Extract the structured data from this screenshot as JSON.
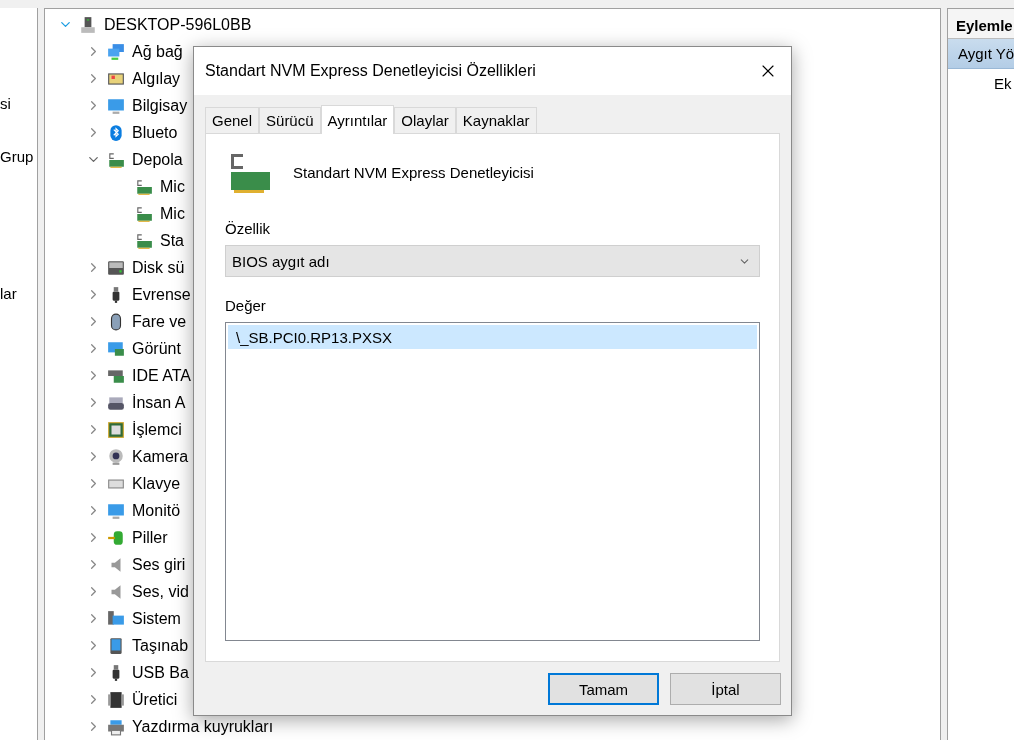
{
  "left_pane": {
    "items": [
      "si",
      "Grup",
      "lar"
    ]
  },
  "device_tree": {
    "root": {
      "label": "DESKTOP-596L0BB",
      "kind": "computer",
      "expanded": true,
      "children": [
        {
          "label": "Ağ bağ",
          "kind": "network",
          "expanded": false
        },
        {
          "label": "Algılay",
          "kind": "sensor",
          "expanded": false
        },
        {
          "label": "Bilgisay",
          "kind": "monitor",
          "expanded": false
        },
        {
          "label": "Blueto",
          "kind": "bluetooth",
          "expanded": false
        },
        {
          "label": "Depola",
          "kind": "storage",
          "expanded": true,
          "children": [
            {
              "label": "Mic",
              "kind": "storage"
            },
            {
              "label": "Mic",
              "kind": "storage"
            },
            {
              "label": "Sta",
              "kind": "storage"
            }
          ]
        },
        {
          "label": "Disk sü",
          "kind": "disk",
          "expanded": false
        },
        {
          "label": "Evrense",
          "kind": "usb",
          "expanded": false
        },
        {
          "label": "Fare ve",
          "kind": "mouse",
          "expanded": false
        },
        {
          "label": "Görünt",
          "kind": "display",
          "expanded": false
        },
        {
          "label": "IDE ATA",
          "kind": "ide",
          "expanded": false
        },
        {
          "label": "İnsan A",
          "kind": "hid",
          "expanded": false
        },
        {
          "label": "İşlemci",
          "kind": "cpu",
          "expanded": false
        },
        {
          "label": "Kamera",
          "kind": "camera",
          "expanded": false
        },
        {
          "label": "Klavye",
          "kind": "keyboard",
          "expanded": false
        },
        {
          "label": "Monitö",
          "kind": "monitor",
          "expanded": false
        },
        {
          "label": "Piller",
          "kind": "battery",
          "expanded": false
        },
        {
          "label": "Ses giri",
          "kind": "audio",
          "expanded": false
        },
        {
          "label": "Ses, vid",
          "kind": "audio",
          "expanded": false
        },
        {
          "label": "Sistem",
          "kind": "system",
          "expanded": false
        },
        {
          "label": "Taşınab",
          "kind": "portable",
          "expanded": false
        },
        {
          "label": "USB Ba",
          "kind": "usb",
          "expanded": false
        },
        {
          "label": "Üretici",
          "kind": "chip",
          "expanded": false
        },
        {
          "label": "Yazdırma kuyrukları",
          "kind": "printer",
          "expanded": false
        }
      ]
    }
  },
  "actions_pane": {
    "header": "Eylemle",
    "items": [
      {
        "label": "Aygıt Yö",
        "selected": true,
        "indent": false
      },
      {
        "label": "Ek",
        "selected": false,
        "indent": true
      }
    ]
  },
  "dialog": {
    "title": "Standart NVM Express Denetleyicisi Özellikleri",
    "tabs": [
      {
        "label": "Genel",
        "selected": false
      },
      {
        "label": "Sürücü",
        "selected": false
      },
      {
        "label": "Ayrıntılar",
        "selected": true
      },
      {
        "label": "Olaylar",
        "selected": false
      },
      {
        "label": "Kaynaklar",
        "selected": false
      }
    ],
    "device_name": "Standart NVM Express Denetleyicisi",
    "property_label": "Özellik",
    "property_value": "BIOS aygıt adı",
    "value_label": "Değer",
    "values": [
      {
        "text": "\\_SB.PCI0.RP13.PXSX",
        "selected": true
      }
    ],
    "buttons": [
      {
        "label": "Tamam",
        "default": true
      },
      {
        "label": "İptal",
        "default": false
      }
    ]
  }
}
